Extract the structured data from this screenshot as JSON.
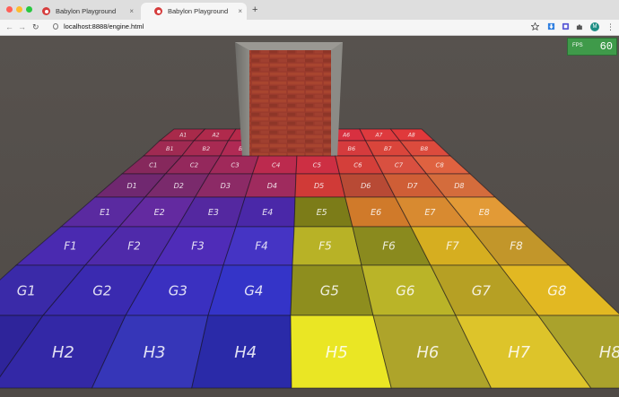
{
  "browser": {
    "tabs": [
      {
        "title": "Babylon Playground",
        "close": "×",
        "active": false
      },
      {
        "title": "Babylon Playground",
        "close": "×",
        "active": true
      }
    ],
    "new_tab": "+",
    "nav": {
      "back": "←",
      "forward": "→",
      "reload": "↻"
    },
    "url": "localhost:8888/engine.html",
    "avatar": "M",
    "menu": "⋮",
    "colors": {
      "close": "#ff5f57",
      "minimize": "#febc2e",
      "zoom": "#28c840"
    }
  },
  "fps": {
    "label": "FPS",
    "value": "60"
  },
  "board": {
    "rows": [
      "A",
      "B",
      "C",
      "D",
      "E",
      "F",
      "G",
      "H"
    ],
    "cols": [
      "1",
      "2",
      "3",
      "4",
      "5",
      "6",
      "7",
      "8"
    ],
    "colors": {
      "A": [
        "#a82a4a",
        "#b02a4c",
        "#b6294a",
        "#c0294c",
        "#cc2a44",
        "#d83040",
        "#de3a3e",
        "#e0393b"
      ],
      "B": [
        "#a02a52",
        "#a82a52",
        "#b02a54",
        "#bb2b52",
        "#c93245",
        "#d53b3d",
        "#da453b",
        "#dc4b3d"
      ],
      "C": [
        "#86285c",
        "#94285c",
        "#a0295a",
        "#bc2a4e",
        "#cd2f43",
        "#d43f3a",
        "#d95040",
        "#df6240"
      ],
      "D": [
        "#702870",
        "#7a2a6c",
        "#8c2a66",
        "#9f2b5e",
        "#d03a37",
        "#b84a35",
        "#cf5e36",
        "#d46c3c"
      ],
      "E": [
        "#5a2aa0",
        "#632aa0",
        "#5428a0",
        "#4a28a8",
        "#7c7c18",
        "#d07a2a",
        "#d88a30",
        "#e29a36"
      ],
      "F": [
        "#4a2ab0",
        "#4f2aaa",
        "#4f2cb8",
        "#4534c4",
        "#b8b226",
        "#8a8a1e",
        "#d6ae20",
        "#c2962a"
      ],
      "G": [
        "#3a2aa8",
        "#3a2ab0",
        "#3a30c0",
        "#3434c8",
        "#8e8e1e",
        "#bab428",
        "#b6a024",
        "#e2b822"
      ],
      "H": [
        "#2e249a",
        "#3328a6",
        "#3636b8",
        "#2a2aa8",
        "#eae624",
        "#aea42a",
        "#ddc42a",
        "#aaa22c"
      ]
    }
  }
}
